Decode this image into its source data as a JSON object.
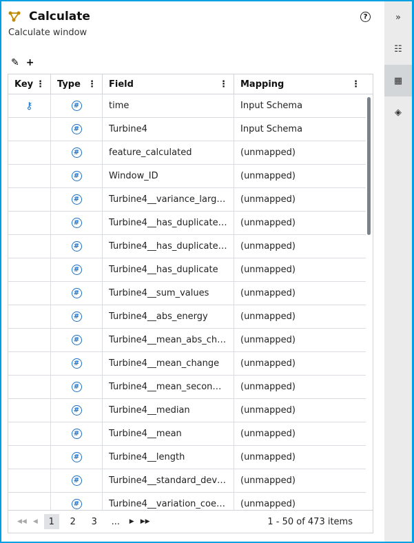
{
  "header": {
    "title": "Calculate",
    "subtitle": "Calculate window",
    "help": "?"
  },
  "toolbar": {
    "edit_icon": "pencil-icon",
    "add_icon": "add-icon"
  },
  "table": {
    "columns": [
      "Key",
      "Type",
      "Field",
      "Mapping"
    ],
    "rows": [
      {
        "key": true,
        "field": "time",
        "mapping": "Input Schema"
      },
      {
        "key": false,
        "field": "Turbine4",
        "mapping": "Input Schema"
      },
      {
        "key": false,
        "field": "feature_calculated",
        "mapping": "(unmapped)"
      },
      {
        "key": false,
        "field": "Window_ID",
        "mapping": "(unmapped)"
      },
      {
        "key": false,
        "field": "Turbine4__variance_larg…",
        "mapping": "(unmapped)"
      },
      {
        "key": false,
        "field": "Turbine4__has_duplicate…",
        "mapping": "(unmapped)"
      },
      {
        "key": false,
        "field": "Turbine4__has_duplicate…",
        "mapping": "(unmapped)"
      },
      {
        "key": false,
        "field": "Turbine4__has_duplicate",
        "mapping": "(unmapped)"
      },
      {
        "key": false,
        "field": "Turbine4__sum_values",
        "mapping": "(unmapped)"
      },
      {
        "key": false,
        "field": "Turbine4__abs_energy",
        "mapping": "(unmapped)"
      },
      {
        "key": false,
        "field": "Turbine4__mean_abs_ch…",
        "mapping": "(unmapped)"
      },
      {
        "key": false,
        "field": "Turbine4__mean_change",
        "mapping": "(unmapped)"
      },
      {
        "key": false,
        "field": "Turbine4__mean_secon…",
        "mapping": "(unmapped)"
      },
      {
        "key": false,
        "field": "Turbine4__median",
        "mapping": "(unmapped)"
      },
      {
        "key": false,
        "field": "Turbine4__mean",
        "mapping": "(unmapped)"
      },
      {
        "key": false,
        "field": "Turbine4__length",
        "mapping": "(unmapped)"
      },
      {
        "key": false,
        "field": "Turbine4__standard_dev…",
        "mapping": "(unmapped)"
      },
      {
        "key": false,
        "field": "Turbine4__variation_coe…",
        "mapping": "(unmapped)"
      }
    ]
  },
  "pagination": {
    "pages": [
      "1",
      "2",
      "3",
      "..."
    ],
    "current": "1",
    "summary": "1 - 50 of 473 items"
  },
  "colors": {
    "border": "#00a1e4",
    "icon": "#1b6fc4",
    "logo": "#c08a00"
  }
}
